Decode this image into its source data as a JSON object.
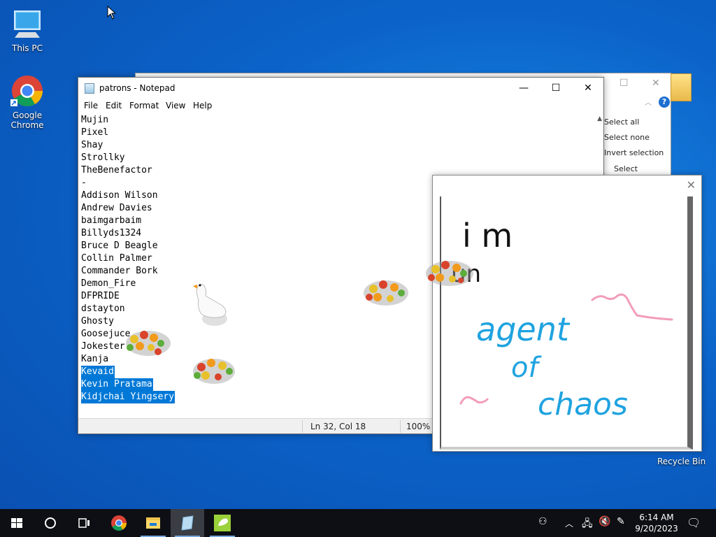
{
  "desktop": {
    "icons": [
      {
        "label": "This PC"
      },
      {
        "label": "Google\nChrome"
      }
    ],
    "recycle_bin_label": "Recycle Bin"
  },
  "explorer": {
    "ribbon": [
      "Select all",
      "Select none",
      "Invert selection",
      "Select"
    ],
    "help": "?"
  },
  "notepad": {
    "title": "patrons - Notepad",
    "menu": [
      "File",
      "Edit",
      "Format",
      "View",
      "Help"
    ],
    "lines": [
      "Mujin",
      "Pixel",
      "Shay",
      "Strollky",
      "TheBenefactor",
      "-",
      "Addison Wilson",
      "Andrew Davies",
      "baimgarbaim",
      "Billyds1324",
      "Bruce D Beagle",
      "Collin Palmer",
      "Commander Bork",
      "Demon_Fire",
      "DFPRIDE",
      "dstayton",
      "Ghosty",
      "Goosejuce",
      "Jokester",
      "Kanja"
    ],
    "selected_lines": [
      "Kevaid",
      "Kevin Pratama",
      "Kidjchai Yingsery"
    ],
    "status": {
      "position": "Ln 32, Col 18",
      "zoom": "100%"
    }
  },
  "drawing": {
    "text_black": [
      "i m",
      "un"
    ],
    "text_blue": [
      "agent",
      "of",
      "chaos"
    ]
  },
  "taskbar": {
    "clock_time": "6:14 AM",
    "clock_date": "9/20/2023"
  },
  "colors": {
    "selection": "#0078d7",
    "ink_black": "#111111",
    "ink_blue": "#1fa3e0",
    "ink_pink": "#f29cbb"
  }
}
